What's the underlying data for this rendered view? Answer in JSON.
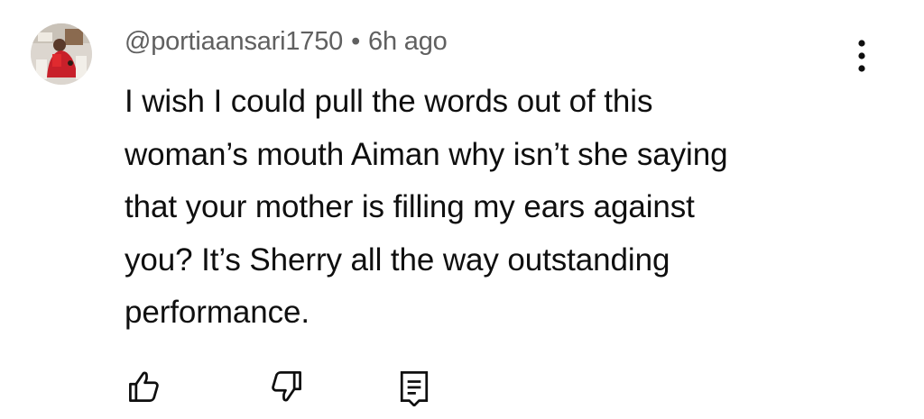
{
  "comment": {
    "author": "@portiaansari1750",
    "separator": "•",
    "timestamp": "6h ago",
    "text_lines": [
      "I wish I could pull the words out of this",
      "woman’s mouth Aiman why isn’t she saying",
      "that your mother is filling my ears against",
      "you? It’s Sherry all the way outstanding",
      "performance."
    ]
  },
  "icons": {
    "menu": "more-vertical-icon",
    "like": "thumbs-up-icon",
    "dislike": "thumbs-down-icon",
    "reply": "reply-comment-icon"
  },
  "colors": {
    "text": "#0f0f0f",
    "meta": "#606060",
    "background": "#ffffff"
  }
}
